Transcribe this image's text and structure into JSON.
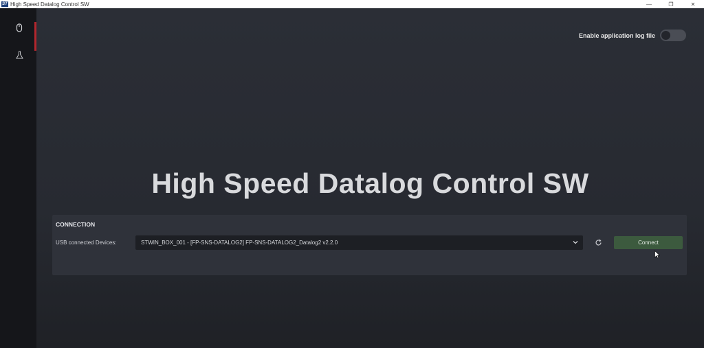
{
  "window": {
    "title": "High Speed Datalog Control SW",
    "logo_text": "ST",
    "controls": {
      "minimize": "—",
      "restore": "❐",
      "close": "✕"
    }
  },
  "sidebar": {
    "items": [
      {
        "icon": "mouse-icon"
      },
      {
        "icon": "flask-icon"
      }
    ]
  },
  "header": {
    "log_toggle_label": "Enable application log file",
    "log_toggle_on": false
  },
  "hero": {
    "title": "High Speed Datalog Control SW"
  },
  "connection": {
    "heading": "CONNECTION",
    "usb_label": "USB connected Devices:",
    "selected_device": "STWIN_BOX_001 - [FP-SNS-DATALOG2] FP-SNS-DATALOG2_Datalog2 v2.2.0",
    "connect_label": "Connect"
  },
  "colors": {
    "accent": "#b3262d",
    "connect_button": "#3c5a3e",
    "background": "#2b2e36"
  }
}
